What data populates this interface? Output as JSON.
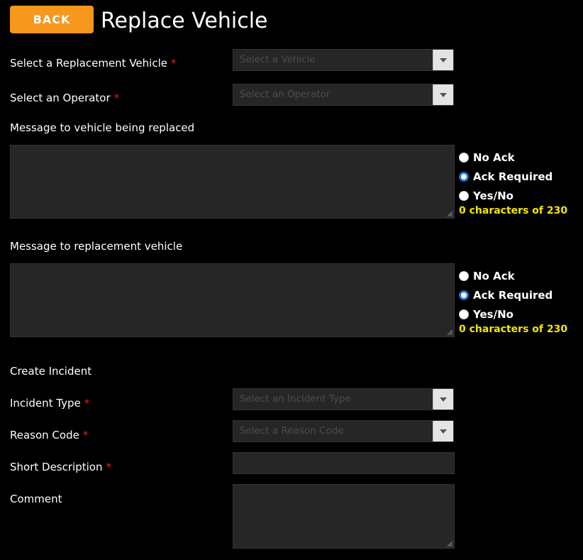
{
  "header": {
    "back_label": "BACK",
    "title": "Replace Vehicle"
  },
  "form": {
    "replacement_vehicle": {
      "label": "Select a Replacement Vehicle",
      "required": "*",
      "placeholder": "Select a Vehicle"
    },
    "operator": {
      "label": "Select an Operator",
      "required": "*",
      "placeholder": "Select an Operator"
    },
    "message_replaced": {
      "label": "Message to vehicle being replaced",
      "options": [
        "No Ack",
        "Ack Required",
        "Yes/No"
      ],
      "selected": "Ack Required",
      "counter": "0 characters of 230"
    },
    "message_replacement": {
      "label": "Message to replacement vehicle",
      "options": [
        "No Ack",
        "Ack Required",
        "Yes/No"
      ],
      "selected": "Ack Required",
      "counter": "0 characters of 230"
    },
    "incident_section": "Create Incident",
    "incident_type": {
      "label": "Incident Type",
      "required": "*",
      "placeholder": "Select an Incident Type"
    },
    "reason_code": {
      "label": "Reason Code",
      "required": "*",
      "placeholder": "Select a Reason Code"
    },
    "short_description": {
      "label": "Short Description",
      "required": "*",
      "value": ""
    },
    "comment": {
      "label": "Comment",
      "value": ""
    }
  },
  "colors": {
    "accent": "#f7981d",
    "required": "#e02020",
    "counter": "#f5e500",
    "radio_selected": "#1b6fd1"
  }
}
